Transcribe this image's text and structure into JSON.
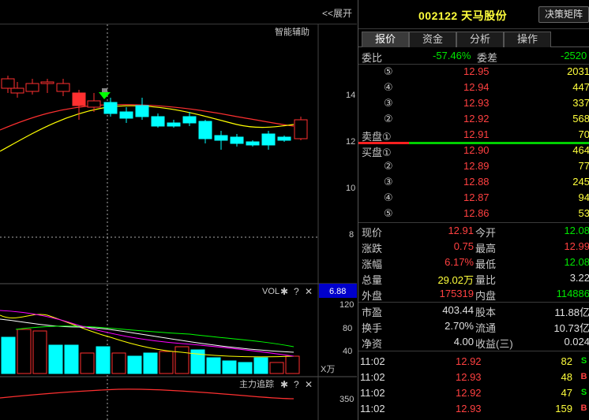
{
  "chart": {
    "expand_label": "<<展开",
    "assist_label": "智能辅助",
    "price_ticks": [
      "14",
      "12",
      "10",
      "8"
    ],
    "current_price_tag": "6.88",
    "vol_label": "VOL",
    "vol_ticks": [
      "120",
      "80",
      "40"
    ],
    "vol_unit": "X万",
    "tracker_label": "主力追踪",
    "tracker_tick": "350",
    "colors": {
      "up": "#ff3030",
      "down": "#00ffff",
      "ma5": "#ffffff",
      "ma10": "#ffff00",
      "ma20": "#ff00ff",
      "ma30": "#00ff00",
      "tag_bg": "#0000cc"
    }
  },
  "panel": {
    "stock_title": "002122 天马股份",
    "matrix_button": "决策矩阵",
    "tabs": [
      "报价",
      "资金",
      "分析",
      "操作"
    ],
    "weibi_label": "委比",
    "weibi_value": "-57.46%",
    "weicha_label": "委差",
    "weicha_value": "-2520",
    "sell": [
      {
        "level": "⑤",
        "price": "12.95",
        "vol": "2031"
      },
      {
        "level": "④",
        "price": "12.94",
        "vol": "447"
      },
      {
        "level": "③",
        "price": "12.93",
        "vol": "337"
      },
      {
        "level": "②",
        "price": "12.92",
        "vol": "568"
      },
      {
        "level": "卖盘①",
        "price": "12.91",
        "vol": "70"
      }
    ],
    "buy": [
      {
        "level": "买盘①",
        "price": "12.90",
        "vol": "464"
      },
      {
        "level": "②",
        "price": "12.89",
        "vol": "77"
      },
      {
        "level": "③",
        "price": "12.88",
        "vol": "245"
      },
      {
        "level": "④",
        "price": "12.87",
        "vol": "94"
      },
      {
        "level": "⑤",
        "price": "12.86",
        "vol": "53"
      }
    ],
    "stats1": [
      {
        "l1": "现价",
        "v1": "12.91",
        "l2": "今开",
        "v2": "12.08"
      },
      {
        "l1": "涨跌",
        "v1": "0.75",
        "l2": "最高",
        "v2": "12.99"
      },
      {
        "l1": "涨幅",
        "v1": "6.17%",
        "l2": "最低",
        "v2": "12.08"
      },
      {
        "l1": "总量",
        "v1": "29.02万",
        "l2": "量比",
        "v2": "3.22"
      },
      {
        "l1": "外盘",
        "v1": "175319",
        "l2": "内盘",
        "v2": "114886"
      }
    ],
    "stats2": [
      {
        "l1": "市盈",
        "v1": "403.44",
        "l2": "股本",
        "v2": "11.88亿"
      },
      {
        "l1": "换手",
        "v1": "2.70%",
        "l2": "流通",
        "v2": "10.73亿"
      },
      {
        "l1": "净资",
        "v1": "4.00",
        "l2": "收益(三)",
        "v2": "0.024"
      }
    ],
    "ticks": [
      {
        "time": "11:02",
        "price": "12.92",
        "vol": "82",
        "side": "S"
      },
      {
        "time": "11:02",
        "price": "12.93",
        "vol": "48",
        "side": "B"
      },
      {
        "time": "11:02",
        "price": "12.92",
        "vol": "47",
        "side": "S"
      },
      {
        "time": "11:02",
        "price": "12.93",
        "vol": "159",
        "side": "B"
      }
    ]
  }
}
